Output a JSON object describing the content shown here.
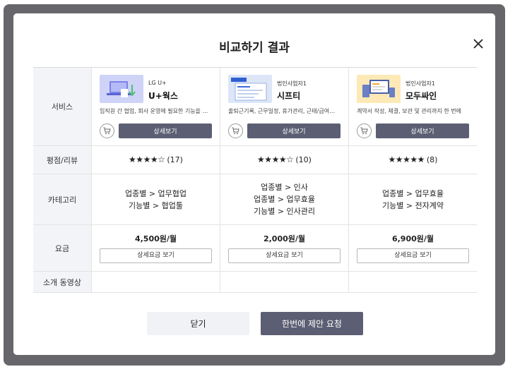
{
  "modal": {
    "title": "비교하기 결과",
    "close_icon": "close-icon"
  },
  "table": {
    "row_headers": {
      "service": "서비스",
      "rating": "평점/리뷰",
      "category": "카테고리",
      "price": "요금",
      "video": "소개 동영상"
    },
    "services": [
      {
        "company": "LG U+",
        "name": "U+웍스",
        "description": "임직원 간 협업, 회사 운영에 필요한 기능을 …",
        "detail_label": "상세보기",
        "stars": "★★★★☆",
        "reviews": "(17)",
        "category_lines": [
          "업종별 > 업무협업",
          "기능별 > 협업툴"
        ],
        "price": "4,500원/월",
        "price_detail_label": "상세요금 보기",
        "thumb_color": "#cfd3f7"
      },
      {
        "company": "법인사업자1",
        "name": "시프티",
        "description": "출퇴근기록, 근무일정, 휴가관리, 근태/급여…",
        "detail_label": "상세보기",
        "stars": "★★★★☆",
        "reviews": "(10)",
        "category_lines": [
          "업종별 > 인사",
          "업종별 > 업무효율",
          "기능별 > 인사관리"
        ],
        "price": "2,000원/월",
        "price_detail_label": "상세요금 보기",
        "thumb_color": "#dce6f7"
      },
      {
        "company": "법인사업자1",
        "name": "모두싸인",
        "description": "계약서 작성, 체결, 보관 및 관리까지 한 번에",
        "detail_label": "상세보기",
        "stars": "★★★★★",
        "reviews": "(8)",
        "category_lines": [
          "업종별 > 업무효율",
          "기능별 > 전자계약"
        ],
        "price": "6,900원/월",
        "price_detail_label": "상세요금 보기",
        "thumb_color": "#fde9b5"
      }
    ]
  },
  "footer": {
    "close_label": "닫기",
    "request_label": "한번에 제안 요청"
  },
  "colors": {
    "primary_button": "#5c5e73",
    "header_cell_bg": "#f3f4f8",
    "overlay": "#67676b"
  }
}
